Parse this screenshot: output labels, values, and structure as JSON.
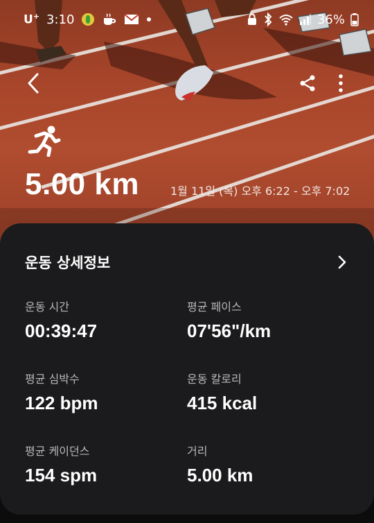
{
  "status_bar": {
    "carrier": "U",
    "carrier_plus": "+",
    "time": "3:10",
    "battery": "36%",
    "icons": [
      "naver-band-icon",
      "coffee-icon",
      "mail-icon",
      "dot-icon",
      "lock-icon",
      "bluetooth-icon",
      "wifi-icon",
      "signal-icon",
      "battery-icon"
    ]
  },
  "app_bar": {
    "back_icon": "chevron-left-icon",
    "share_icon": "share-icon",
    "more_icon": "more-vertical-icon"
  },
  "workout": {
    "type_icon": "running-icon",
    "distance": "5.00 km",
    "datetime": "1월 11일 (목) 오후 6:22 - 오후 7:02"
  },
  "details": {
    "title": "운동 상세정보",
    "chevron_icon": "chevron-right-icon",
    "metrics": [
      {
        "label": "운동 시간",
        "value": "00:39:47"
      },
      {
        "label": "평균 페이스",
        "value": "07'56\"/km"
      },
      {
        "label": "평균 심박수",
        "value": "122 bpm"
      },
      {
        "label": "운동 칼로리",
        "value": "415 kcal"
      },
      {
        "label": "평균 케이던스",
        "value": "154 spm"
      },
      {
        "label": "거리",
        "value": "5.00 km"
      }
    ]
  },
  "colors": {
    "track": "#a8462b",
    "card_background": "#1b1b1d",
    "label_text": "#b9b9bd"
  }
}
